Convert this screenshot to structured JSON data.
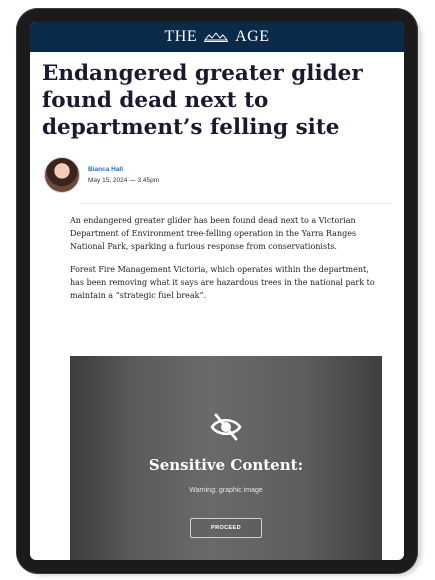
{
  "masthead": {
    "left": "THE",
    "right": "AGE",
    "crest_icon": "crest-icon"
  },
  "article": {
    "headline": "Endangered greater glider found dead next to department’s felling site",
    "author": "Bianca Hall",
    "date": "May 15, 2024 — 3.45pm",
    "paragraphs": [
      "An endangered greater glider has been found dead next to a Victorian Department of Environment tree-felling operation in the Yarra Ranges National Park, sparking a furious response from conservationists.",
      "Forest Fire Management Victoria, which operates within the department, has been removing what it says are hazardous trees in the national park to maintain a “strategic fuel break”."
    ]
  },
  "sensitive_content": {
    "icon": "eye-slash-icon",
    "title": "Sensitive Content:",
    "warning": "Warning: graphic image",
    "button_label": "PROCEED"
  },
  "colors": {
    "masthead_bg": "#0a2a4a",
    "author_link": "#1f6fd1",
    "headline": "#1a1a2e"
  }
}
